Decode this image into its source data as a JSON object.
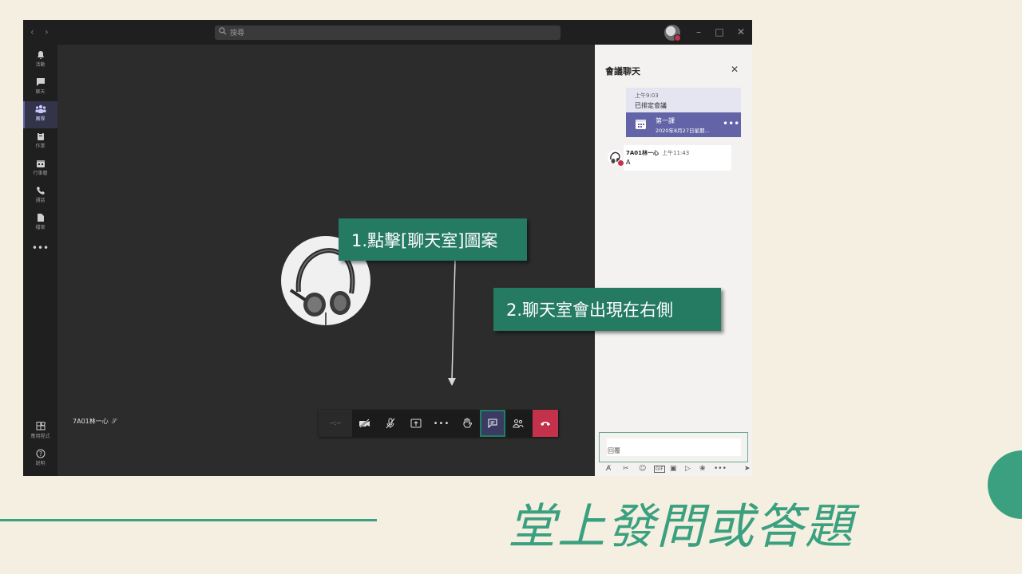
{
  "titlebar": {
    "search_placeholder": "搜尋"
  },
  "rail": {
    "items": [
      {
        "label": "活動",
        "icon": "bell-icon"
      },
      {
        "label": "聊天",
        "icon": "chat-icon"
      },
      {
        "label": "團隊",
        "icon": "teams-icon"
      },
      {
        "label": "作業",
        "icon": "assignment-icon"
      },
      {
        "label": "行事曆",
        "icon": "calendar-icon"
      },
      {
        "label": "通話",
        "icon": "phone-icon"
      },
      {
        "label": "檔案",
        "icon": "file-icon"
      },
      {
        "label": "應用程式",
        "icon": "apps-icon"
      },
      {
        "label": "說明",
        "icon": "help-icon"
      }
    ],
    "active": "團隊"
  },
  "stage": {
    "participant_name": "7A01林一心",
    "controls": {
      "timer": "--:--"
    }
  },
  "chat": {
    "title": "會議聊天",
    "meeting": {
      "time": "上午9:03",
      "status": "已排定會議",
      "title": "第一課",
      "date": "2020年8月27日星期..."
    },
    "message": {
      "author": "7A01林一心",
      "time": "上午11:43",
      "body": "A"
    },
    "reply_placeholder": "回覆"
  },
  "callouts": {
    "step1": "1.點擊[聊天室]圖案",
    "step2": "2.聊天室會出現在右側"
  },
  "slide": {
    "title": "堂上發問或答題",
    "accent_color": "#3aa07f"
  }
}
